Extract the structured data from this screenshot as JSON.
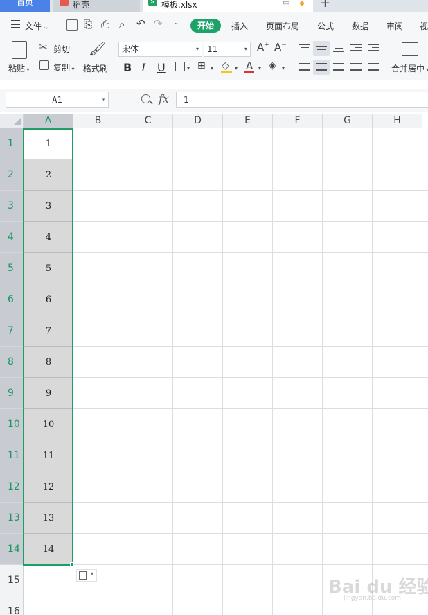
{
  "tabs": {
    "home": "首页",
    "daoke": "稻壳",
    "file": "模板.xlsx",
    "file_icon": "S"
  },
  "menu": {
    "file": "文件",
    "items": [
      "开始",
      "插入",
      "页面布局",
      "公式",
      "数据",
      "审阅",
      "视"
    ]
  },
  "ribbon": {
    "paste": "粘贴",
    "cut": "剪切",
    "copy": "复制",
    "format_painter": "格式刷",
    "font_name": "宋体",
    "font_size": "11",
    "bold": "B",
    "italic": "I",
    "underline": "U",
    "merge_center": "合并居中"
  },
  "formula_bar": {
    "name_box": "A1",
    "fx": "fx",
    "value": "1"
  },
  "grid": {
    "columns": [
      "A",
      "B",
      "C",
      "D",
      "E",
      "F",
      "G",
      "H"
    ],
    "rows": [
      "1",
      "2",
      "3",
      "4",
      "5",
      "6",
      "7",
      "8",
      "9",
      "10",
      "11",
      "12",
      "13",
      "14",
      "15",
      "16"
    ],
    "column_a_values": [
      "1",
      "2",
      "3",
      "4",
      "5",
      "6",
      "7",
      "8",
      "9",
      "10",
      "11",
      "12",
      "13",
      "14"
    ],
    "selected_column": "A",
    "active_cell": "A1"
  },
  "colors": {
    "accent_green": "#1f9d63",
    "tab_home_blue": "#4a82e8"
  },
  "watermark": {
    "text": "Bai du 经验",
    "sub": "jingyan.baidu.com"
  }
}
